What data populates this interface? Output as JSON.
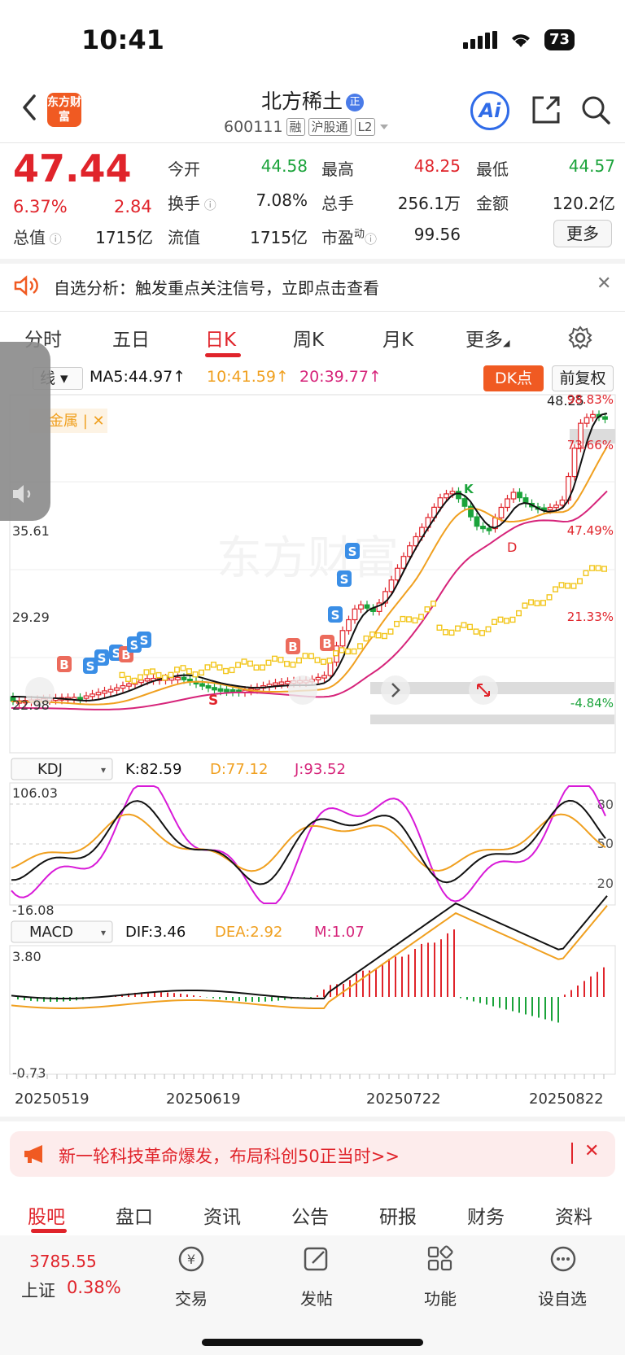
{
  "status_bar": {
    "time": "10:41",
    "battery": "73"
  },
  "header": {
    "stock_name": "北方稀土",
    "stock_code": "600111",
    "tags": [
      "融",
      "沪股通",
      "L2"
    ],
    "logo_text": "东方财富",
    "ai_label": "Ai"
  },
  "quote": {
    "price": "47.44",
    "change_pct": "6.37%",
    "change_amt": "2.84",
    "open_label": "今开",
    "open": "44.58",
    "high_label": "最高",
    "high": "48.25",
    "low_label": "最低",
    "low": "44.57",
    "turnover_label": "换手",
    "turnover": "7.08%",
    "volume_label": "总手",
    "volume": "256.1万",
    "amount_label": "金额",
    "amount": "120.2亿",
    "mktcap_label": "总值",
    "mktcap": "1715亿",
    "float_label": "流值",
    "float": "1715亿",
    "pe_label": "市盈",
    "pe_sup": "动",
    "pe": "99.56",
    "more_label": "更多"
  },
  "notice": {
    "text": "自选分析：触发重点关注信号，立即点击查看"
  },
  "tabs": [
    "分时",
    "五日",
    "日K",
    "周K",
    "月K",
    "更多"
  ],
  "ma_bar": {
    "selector": "线",
    "ma5": "MA5:44.97",
    "ma10": "10:41.59",
    "ma20": "20:39.77",
    "dk_label": "DK点",
    "adjust_label": "前复权"
  },
  "kline": {
    "top_price": "48.25",
    "price_label_1": "35.61",
    "price_label_2": "29.29",
    "price_label_3": "22.98",
    "price_label_4": "22.98",
    "pct_labels": [
      "98.83%",
      "73.66%",
      "47.49%",
      "21.33%",
      "-4.84%"
    ],
    "overlay_tag": "金属 | ✕",
    "watermark": "东方财富",
    "colors": {
      "up": "#e0242b",
      "down": "#1aa33a",
      "ma5": "#111111",
      "ma10": "#f0a020",
      "ma20": "#d6247a",
      "vol_yellow": "#f2c61c"
    }
  },
  "kdj": {
    "selector": "KDJ",
    "k": "K:82.59",
    "d": "D:77.12",
    "j": "J:93.52",
    "y_top": "106.03",
    "y_bottom": "-16.08",
    "levels": [
      "80",
      "50",
      "20"
    ]
  },
  "macd": {
    "selector": "MACD",
    "dif": "DIF:3.46",
    "dea": "DEA:2.92",
    "m": "M:1.07",
    "y_top": "3.80",
    "y_bottom": "-0.73"
  },
  "dates": [
    "20250519",
    "20250619",
    "20250722",
    "20250822"
  ],
  "promo": {
    "text": "新一轮科技革命爆发，布局科创50正当时>>"
  },
  "bottom_tabs": [
    "股吧",
    "盘口",
    "资讯",
    "公告",
    "研报",
    "财务",
    "资料"
  ],
  "footer": {
    "index_value": "3785.55",
    "index_name": "上证",
    "index_pct": "0.38%",
    "items": [
      "交易",
      "发帖",
      "功能",
      "设自选"
    ]
  }
}
